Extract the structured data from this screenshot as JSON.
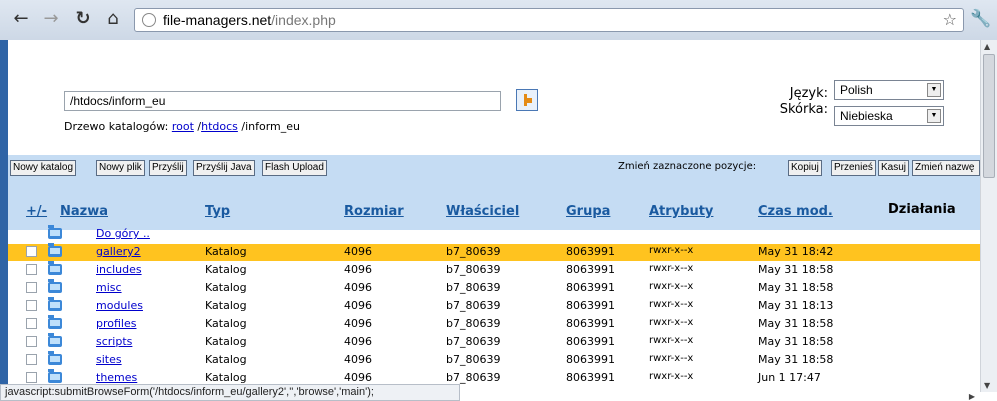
{
  "browser": {
    "url_host": "file-managers.net",
    "url_path": "/index.php",
    "status_text": "javascript:submitBrowseForm('/htdocs/inform_eu/gallery2','','browse','main');"
  },
  "top": {
    "path_value": "/htdocs/inform_eu",
    "tree_label": "Drzewo katalogów:",
    "tree_links": [
      "root",
      "htdocs"
    ],
    "tree_current": "/inform_eu",
    "lang_label": "Język:",
    "lang_value": "Polish",
    "skin_label": "Skórka:",
    "skin_value": "Niebieska"
  },
  "toolbar": {
    "buttons": [
      "Nowy katalog",
      "Nowy plik",
      "Przyślij",
      "Przyślij Java",
      "Flash Upload"
    ],
    "selection_label": "Zmień zaznaczone pozycje:",
    "selection_buttons": [
      "Kopiuj",
      "Przenieś",
      "Kasuj",
      "Zmień nazwę"
    ]
  },
  "table": {
    "headers": [
      "+/-",
      "Nazwa",
      "Typ",
      "Rozmiar",
      "Właściciel",
      "Grupa",
      "Atrybuty",
      "Czas mod.",
      "Działania"
    ],
    "up_link": "Do góry ..",
    "rows": [
      {
        "name": "gallery2",
        "type": "Katalog",
        "size": "4096",
        "owner": "b7_80639",
        "group": "8063991",
        "attrs": "rwxr-x--x",
        "mtime": "May 31 18:42",
        "selected": true
      },
      {
        "name": "includes",
        "type": "Katalog",
        "size": "4096",
        "owner": "b7_80639",
        "group": "8063991",
        "attrs": "rwxr-x--x",
        "mtime": "May 31 18:58"
      },
      {
        "name": "misc",
        "type": "Katalog",
        "size": "4096",
        "owner": "b7_80639",
        "group": "8063991",
        "attrs": "rwxr-x--x",
        "mtime": "May 31 18:58"
      },
      {
        "name": "modules",
        "type": "Katalog",
        "size": "4096",
        "owner": "b7_80639",
        "group": "8063991",
        "attrs": "rwxr-x--x",
        "mtime": "May 31 18:13"
      },
      {
        "name": "profiles",
        "type": "Katalog",
        "size": "4096",
        "owner": "b7_80639",
        "group": "8063991",
        "attrs": "rwxr-x--x",
        "mtime": "May 31 18:58"
      },
      {
        "name": "scripts",
        "type": "Katalog",
        "size": "4096",
        "owner": "b7_80639",
        "group": "8063991",
        "attrs": "rwxr-x--x",
        "mtime": "May 31 18:58"
      },
      {
        "name": "sites",
        "type": "Katalog",
        "size": "4096",
        "owner": "b7_80639",
        "group": "8063991",
        "attrs": "rwxr-x--x",
        "mtime": "May 31 18:58"
      },
      {
        "name": "themes",
        "type": "Katalog",
        "size": "4096",
        "owner": "b7_80639",
        "group": "8063991",
        "attrs": "rwxr-x--x",
        "mtime": "Jun 1 17:47"
      }
    ]
  }
}
